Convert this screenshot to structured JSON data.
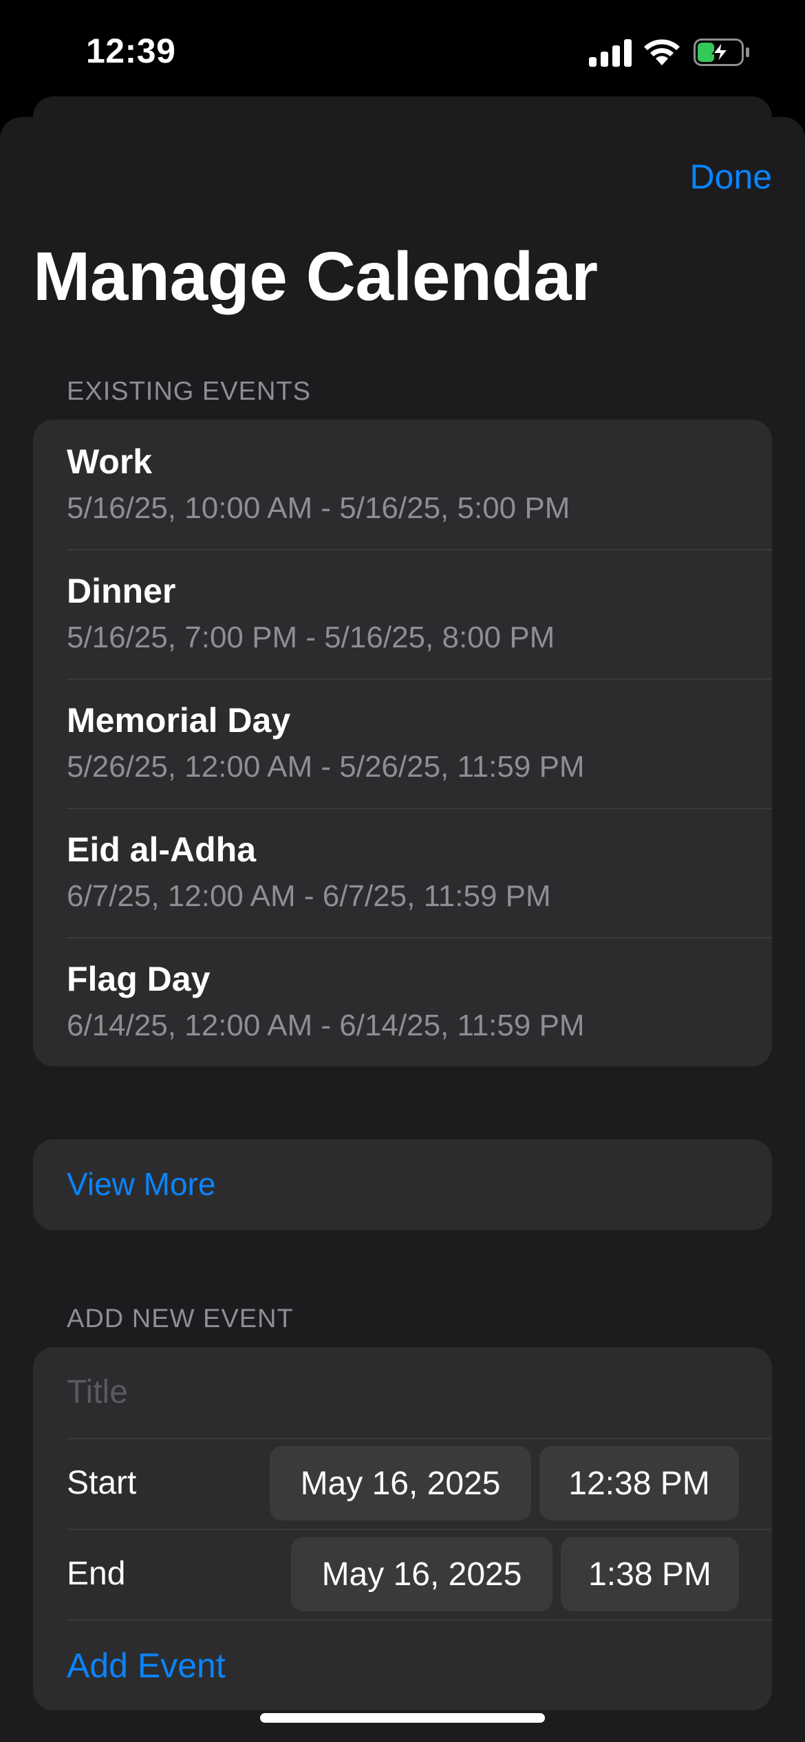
{
  "status_bar": {
    "time": "12:39"
  },
  "header": {
    "done_label": "Done",
    "title": "Manage Calendar"
  },
  "existing_events": {
    "section_label": "EXISTING EVENTS",
    "items": [
      {
        "title": "Work",
        "range": "5/16/25, 10:00 AM - 5/16/25, 5:00 PM"
      },
      {
        "title": "Dinner",
        "range": "5/16/25, 7:00 PM - 5/16/25, 8:00 PM"
      },
      {
        "title": "Memorial Day",
        "range": "5/26/25, 12:00 AM - 5/26/25, 11:59 PM"
      },
      {
        "title": "Eid al-Adha",
        "range": "6/7/25, 12:00 AM - 6/7/25, 11:59 PM"
      },
      {
        "title": "Flag Day",
        "range": "6/14/25, 12:00 AM - 6/14/25, 11:59 PM"
      }
    ],
    "view_more_label": "View More"
  },
  "add_event": {
    "section_label": "ADD NEW EVENT",
    "title_placeholder": "Title",
    "title_value": "",
    "start_label": "Start",
    "start_date": "May 16, 2025",
    "start_time": "12:38 PM",
    "end_label": "End",
    "end_date": "May 16, 2025",
    "end_time": "1:38 PM",
    "submit_label": "Add Event"
  },
  "colors": {
    "accent": "#0a84ff",
    "sheet_background": "#1c1c1e",
    "group_background": "#2c2c2e",
    "battery_charging": "#34c759"
  }
}
